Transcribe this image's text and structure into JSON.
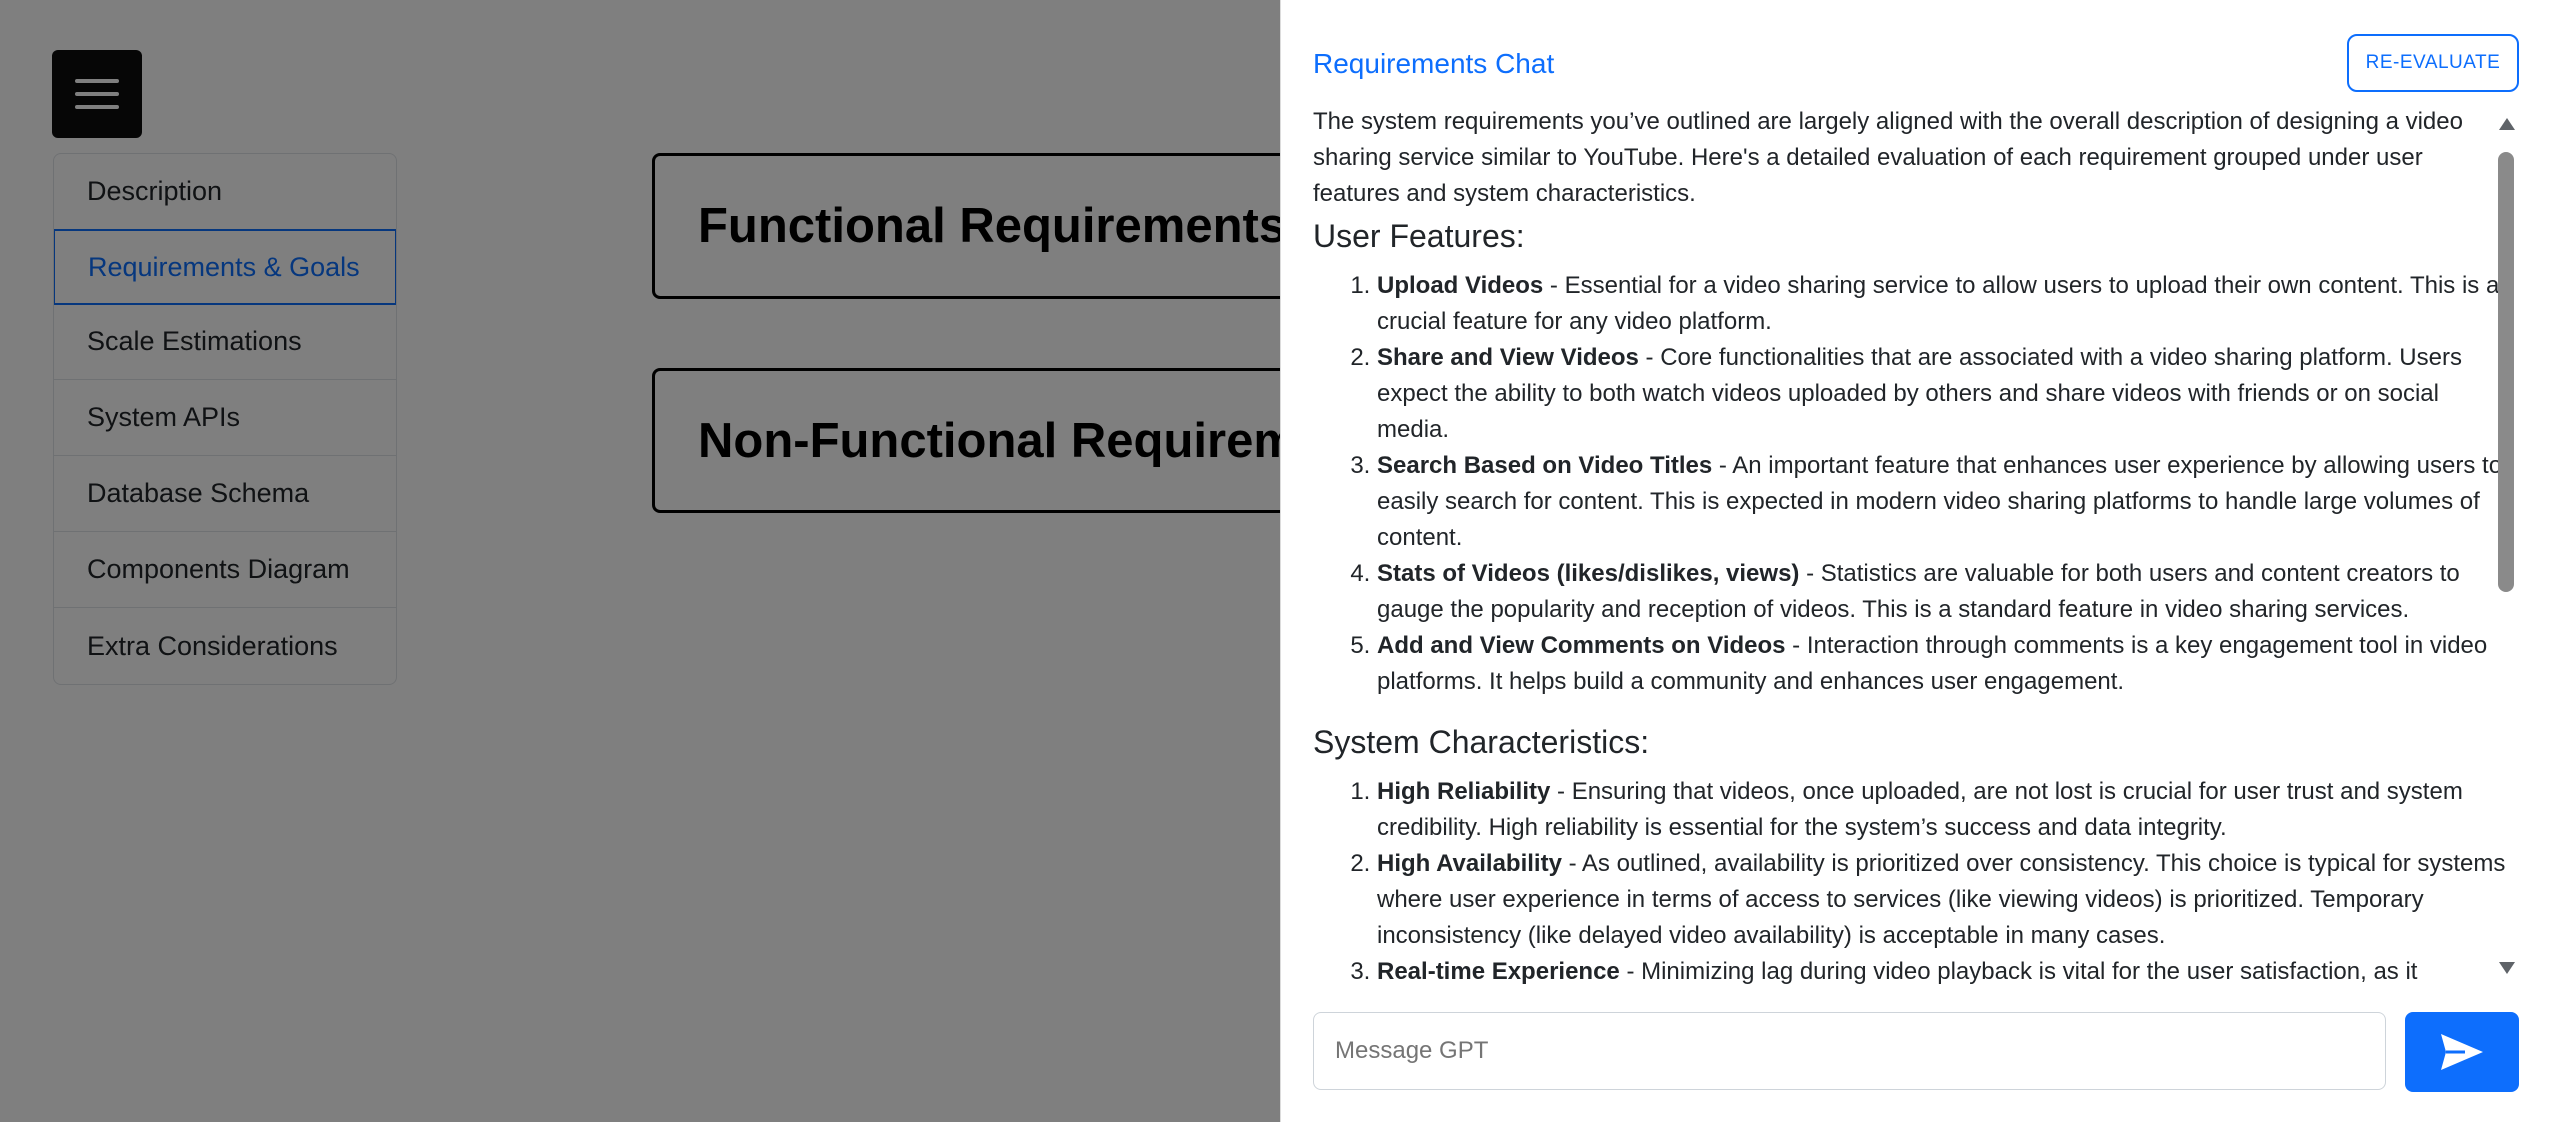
{
  "sidebar": {
    "items": [
      {
        "label": "Description"
      },
      {
        "label": "Requirements & Goals"
      },
      {
        "label": "Scale Estimations"
      },
      {
        "label": "System APIs"
      },
      {
        "label": "Database Schema"
      },
      {
        "label": "Components Diagram"
      },
      {
        "label": "Extra Considerations"
      }
    ],
    "active_label": "Requirements & Goals"
  },
  "main": {
    "cards": [
      {
        "title": "Functional Requirements"
      },
      {
        "title": "Non-Functional Requirements"
      }
    ]
  },
  "panel": {
    "title": "Requirements Chat",
    "reevaluate_label": "RE-EVALUATE",
    "intro": "The system requirements you’ve outlined are largely aligned with the overall description of designing a video sharing service similar to YouTube. Here's a detailed evaluation of each requirement grouped under user features and system characteristics.",
    "sections": [
      {
        "heading": "User Features:",
        "items": [
          {
            "title": "Upload Videos",
            "text": " - Essential for a video sharing service to allow users to upload their own content. This is a crucial feature for any video platform."
          },
          {
            "title": "Share and View Videos",
            "text": " - Core functionalities that are associated with a video sharing platform. Users expect the ability to both watch videos uploaded by others and share videos with friends or on social media."
          },
          {
            "title": "Search Based on Video Titles",
            "text": " - An important feature that enhances user experience by allowing users to easily search for content. This is expected in modern video sharing platforms to handle large volumes of content."
          },
          {
            "title": "Stats of Videos (likes/dislikes, views)",
            "text": " - Statistics are valuable for both users and content creators to gauge the popularity and reception of videos. This is a standard feature in video sharing services."
          },
          {
            "title": "Add and View Comments on Videos",
            "text": " - Interaction through comments is a key engagement tool in video platforms. It helps build a community and enhances user engagement."
          }
        ]
      },
      {
        "heading": "System Characteristics:",
        "items": [
          {
            "title": "High Reliability",
            "text": " - Ensuring that videos, once uploaded, are not lost is crucial for user trust and system credibility. High reliability is essential for the system’s success and data integrity."
          },
          {
            "title": "High Availability",
            "text": " - As outlined, availability is prioritized over consistency. This choice is typical for systems where user experience in terms of access to services (like viewing videos) is prioritized. Temporary inconsistency (like delayed video availability) is acceptable in many cases."
          },
          {
            "title": "Real-time Experience",
            "text": " - Minimizing lag during video playback is vital for the user satisfaction, as it"
          }
        ]
      }
    ],
    "input_placeholder": "Message GPT"
  },
  "icons": {
    "menu": "hamburger-menu-icon",
    "send": "paper-plane-send-icon",
    "scroll_up": "triangle-up-icon",
    "scroll_down": "triangle-down-icon"
  },
  "colors": {
    "accent": "#0d6efd",
    "menu_button": "#0d0d0d",
    "overlay": "rgba(0,0,0,0.5)"
  }
}
